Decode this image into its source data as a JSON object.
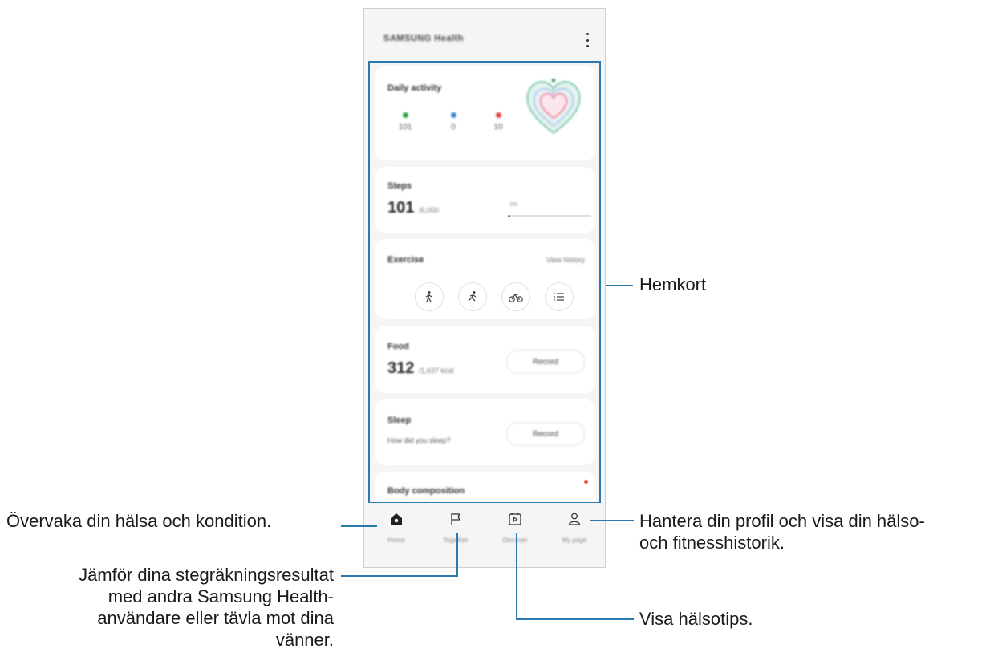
{
  "app": {
    "title": "SAMSUNG Health"
  },
  "daily_activity": {
    "title": "Daily activity",
    "metrics": [
      {
        "icon": "steps-icon",
        "value": "101",
        "color": "#2fa34a"
      },
      {
        "icon": "activity-time-icon",
        "value": "0",
        "color": "#3b87d8"
      },
      {
        "icon": "calories-icon",
        "value": "10",
        "color": "#e8464d"
      }
    ]
  },
  "steps": {
    "title": "Steps",
    "value": "101",
    "unit": "/6,000",
    "progress_label": "2%",
    "progress": 0.02
  },
  "exercise": {
    "title": "Exercise",
    "link": "View history",
    "buttons": [
      "walking-icon",
      "running-icon",
      "cycling-icon",
      "list-icon"
    ]
  },
  "food": {
    "title": "Food",
    "value": "312",
    "unit": "/1,637 kcal",
    "button": "Record"
  },
  "sleep": {
    "title": "Sleep",
    "subtitle": "How did you sleep?",
    "button": "Record"
  },
  "body_composition": {
    "title": "Body composition"
  },
  "nav": [
    {
      "icon": "home-icon",
      "label": "Home"
    },
    {
      "icon": "together-flag-icon",
      "label": "Together"
    },
    {
      "icon": "discover-icon",
      "label": "Discover"
    },
    {
      "icon": "profile-icon",
      "label": "My page"
    }
  ],
  "annotations": {
    "hemkort": "Hemkort",
    "home": "Övervaka din hälsa och kondition.",
    "profile_line1": "Hantera din profil och visa din hälso-",
    "profile_line2": "och fitnesshistorik.",
    "together_line1": "Jämför dina stegräkningsresultat",
    "together_line2": "med andra Samsung Health-",
    "together_line3": "användare eller tävla mot dina",
    "together_line4": "vänner.",
    "discover": "Visa hälsotips."
  },
  "colors": {
    "callout_line": "#2a7ab0",
    "accent_green": "#2fa34a"
  }
}
